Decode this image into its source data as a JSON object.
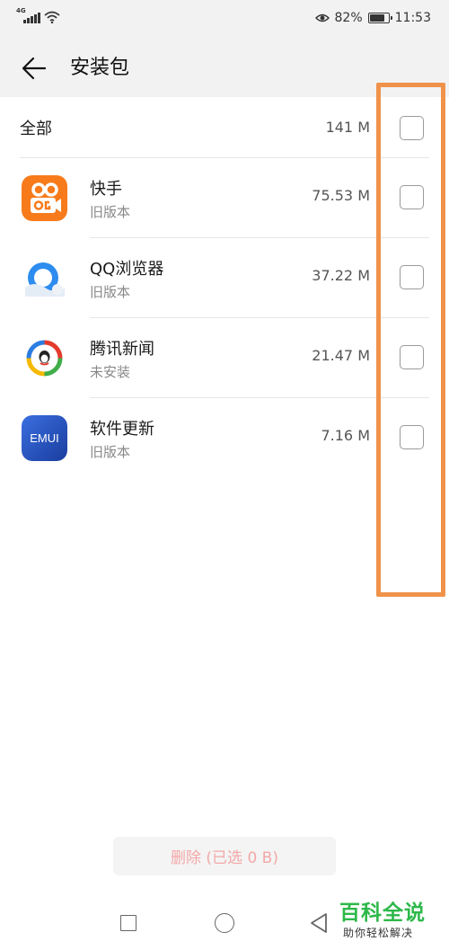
{
  "status_bar": {
    "network_type": "4G",
    "battery_percent": "82%",
    "battery_level": 0.82,
    "time": "11:53"
  },
  "header": {
    "title": "安装包"
  },
  "list": {
    "all": {
      "label": "全部",
      "size": "141 M",
      "checked": false
    },
    "apps": [
      {
        "name": "快手",
        "status": "旧版本",
        "size": "75.53 M",
        "icon": "kuaishou-icon",
        "checked": false
      },
      {
        "name": "QQ浏览器",
        "status": "旧版本",
        "size": "37.22 M",
        "icon": "qq-browser-icon",
        "checked": false
      },
      {
        "name": "腾讯新闻",
        "status": "未安装",
        "size": "21.47 M",
        "icon": "tencent-news-icon",
        "checked": false
      },
      {
        "name": "软件更新",
        "status": "旧版本",
        "size": "7.16 M",
        "icon": "emui-icon",
        "checked": false
      }
    ]
  },
  "footer": {
    "delete_label": "删除 (已选 0 B)"
  },
  "emui_icon_text": "EMUI",
  "watermark": {
    "title": "百科全说",
    "subtitle": "助你轻松解决"
  },
  "colors": {
    "highlight": "#f0924a",
    "delete_text": "#f3a8a8",
    "watermark_green": "#2db84a",
    "kuaishou_orange": "#f77b1b",
    "qq_blue": "#2d8cf0",
    "emui_blue": "#1f4fb8"
  }
}
